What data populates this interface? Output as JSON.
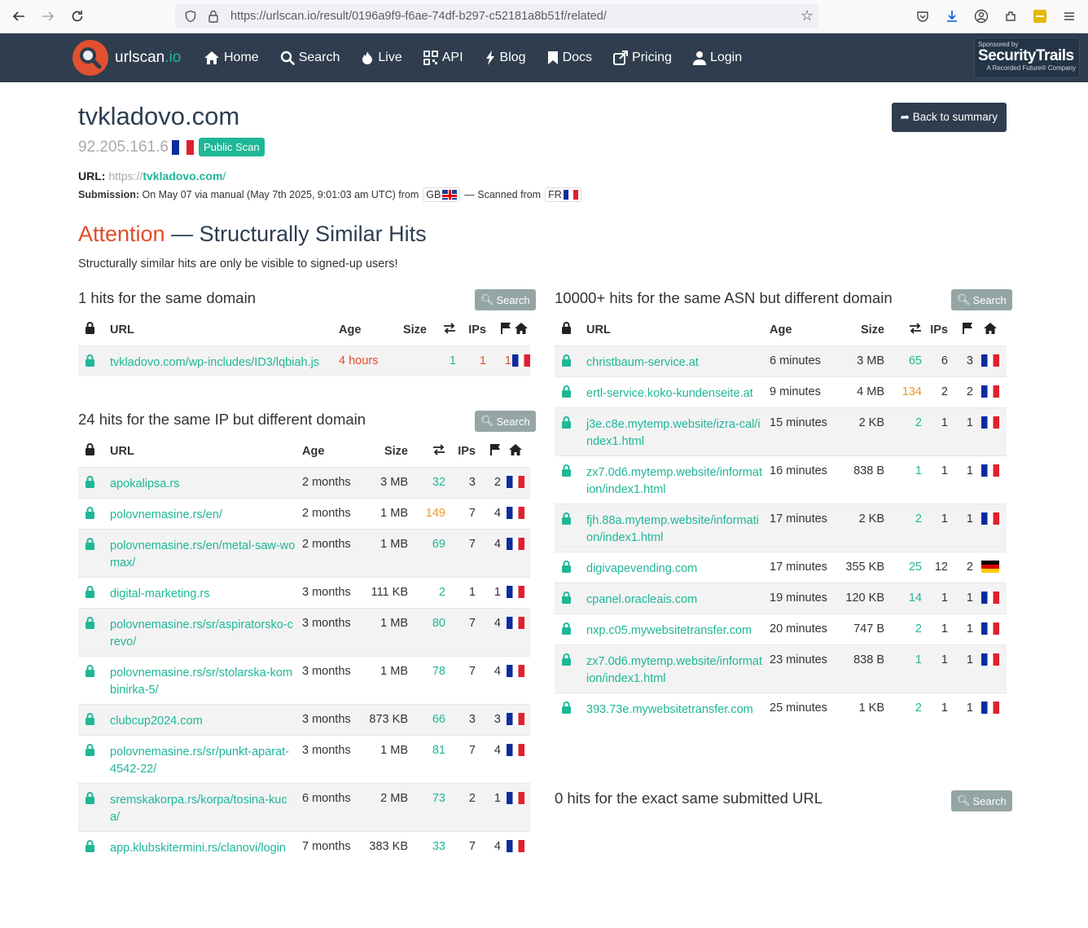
{
  "browser": {
    "url": "https://urlscan.io/result/0196a9f9-f6ae-74df-b297-c52181a8b51f/related/"
  },
  "navbar": {
    "logo_text": "urlscan",
    "logo_suffix": ".io",
    "items": [
      {
        "label": "Home",
        "icon": "home-icon"
      },
      {
        "label": "Search",
        "icon": "search-icon"
      },
      {
        "label": "Live",
        "icon": "fire-icon"
      },
      {
        "label": "API",
        "icon": "qrcode-icon"
      },
      {
        "label": "Blog",
        "icon": "bolt-icon"
      },
      {
        "label": "Docs",
        "icon": "bookmark-icon"
      },
      {
        "label": "Pricing",
        "icon": "external-link-icon"
      },
      {
        "label": "Login",
        "icon": "user-icon"
      }
    ],
    "sponsor_small": "Sponsored by",
    "sponsor_name": "SecurityTrails",
    "sponsor_sub": "A Recorded Future® Company"
  },
  "header": {
    "domain": "tvkladovo.com",
    "ip": "92.205.161.6",
    "badge": "Public Scan",
    "back_button": "Back to summary",
    "url_label": "URL:",
    "url_scheme": "https://",
    "url_host": "tvkladovo.com",
    "url_path": "/",
    "submission_label": "Submission:",
    "submission_text": "On May 07 via manual (May 7th 2025, 9:01:03 am UTC) from",
    "from_country": "GB",
    "scanned_text": "— Scanned from",
    "scanned_country": "FR"
  },
  "attention": {
    "word": "Attention",
    "rest": " — Structurally Similar Hits",
    "subtitle": "Structurally similar hits are only be visible to signed-up users!"
  },
  "search_label": "Search",
  "columns": {
    "url": "URL",
    "age": "Age",
    "size": "Size",
    "ips": "IPs"
  },
  "same_domain": {
    "title": "1 hits for the same domain",
    "rows": [
      {
        "url": "tvkladovo.com/wp-includes/ID3/lqbiah.js",
        "age": "4 hours",
        "size": "",
        "req": "1",
        "ips": "1",
        "flags": "1",
        "country": "FR"
      }
    ]
  },
  "same_ip": {
    "title": "24 hits for the same IP but different domain",
    "rows": [
      {
        "url": "apokalipsa.rs",
        "age": "2 months",
        "size": "3 MB",
        "req": "32",
        "ips": "3",
        "flags": "2",
        "country": "FR"
      },
      {
        "url": "polovnemasine.rs/en/",
        "age": "2 months",
        "size": "1 MB",
        "req": "149",
        "ips": "7",
        "flags": "4",
        "country": "FR"
      },
      {
        "url": "polovnemasine.rs/en/metal-saw-womax/",
        "age": "2 months",
        "size": "1 MB",
        "req": "69",
        "ips": "7",
        "flags": "4",
        "country": "FR"
      },
      {
        "url": "digital-marketing.rs",
        "age": "3 months",
        "size": "111 KB",
        "req": "2",
        "ips": "1",
        "flags": "1",
        "country": "FR"
      },
      {
        "url": "polovnemasine.rs/sr/aspiratorsko-crevo/",
        "age": "3 months",
        "size": "1 MB",
        "req": "80",
        "ips": "7",
        "flags": "4",
        "country": "FR"
      },
      {
        "url": "polovnemasine.rs/sr/stolarska-kombinirka-5/",
        "age": "3 months",
        "size": "1 MB",
        "req": "78",
        "ips": "7",
        "flags": "4",
        "country": "FR"
      },
      {
        "url": "clubcup2024.com",
        "age": "3 months",
        "size": "873 KB",
        "req": "66",
        "ips": "3",
        "flags": "3",
        "country": "FR"
      },
      {
        "url": "polovnemasine.rs/sr/punkt-aparat-4542-22/",
        "age": "3 months",
        "size": "1 MB",
        "req": "81",
        "ips": "7",
        "flags": "4",
        "country": "FR"
      },
      {
        "url": "sremskakorpa.rs/korpa/tosina-kuca/",
        "age": "6 months",
        "size": "2 MB",
        "req": "73",
        "ips": "2",
        "flags": "1",
        "country": "FR"
      },
      {
        "url": "app.klubskitermini.rs/clanovi/login",
        "age": "7 months",
        "size": "383 KB",
        "req": "33",
        "ips": "7",
        "flags": "4",
        "country": "FR"
      }
    ]
  },
  "same_asn": {
    "title": "10000+ hits for the same ASN but different domain",
    "rows": [
      {
        "url": "christbaum-service.at",
        "age": "6 minutes",
        "size": "3 MB",
        "req": "65",
        "ips": "6",
        "flags": "3",
        "country": "FR"
      },
      {
        "url": "ertl-service.koko-kundenseite.at",
        "age": "9 minutes",
        "size": "4 MB",
        "req": "134",
        "ips": "2",
        "flags": "2",
        "country": "FR"
      },
      {
        "url": "j3e.c8e.mytemp.website/izra-cal/index1.html",
        "age": "15 minutes",
        "size": "2 KB",
        "req": "2",
        "ips": "1",
        "flags": "1",
        "country": "FR"
      },
      {
        "url": "zx7.0d6.mytemp.website/information/index1.html",
        "age": "16 minutes",
        "size": "838 B",
        "req": "1",
        "ips": "1",
        "flags": "1",
        "country": "FR"
      },
      {
        "url": "fjh.88a.mytemp.website/information/index1.html",
        "age": "17 minutes",
        "size": "2 KB",
        "req": "2",
        "ips": "1",
        "flags": "1",
        "country": "FR"
      },
      {
        "url": "digivapevending.com",
        "age": "17 minutes",
        "size": "355 KB",
        "req": "25",
        "ips": "12",
        "flags": "2",
        "country": "DE"
      },
      {
        "url": "cpanel.oracleais.com",
        "age": "19 minutes",
        "size": "120 KB",
        "req": "14",
        "ips": "1",
        "flags": "1",
        "country": "FR"
      },
      {
        "url": "nxp.c05.mywebsitetransfer.com",
        "age": "20 minutes",
        "size": "747 B",
        "req": "2",
        "ips": "1",
        "flags": "1",
        "country": "FR"
      },
      {
        "url": "zx7.0d6.mytemp.website/information/index1.html",
        "age": "23 minutes",
        "size": "838 B",
        "req": "1",
        "ips": "1",
        "flags": "1",
        "country": "FR"
      },
      {
        "url": "393.73e.mywebsitetransfer.com",
        "age": "25 minutes",
        "size": "1 KB",
        "req": "2",
        "ips": "1",
        "flags": "1",
        "country": "FR"
      }
    ]
  },
  "exact_url": {
    "title": "0 hits for the exact same submitted URL"
  }
}
